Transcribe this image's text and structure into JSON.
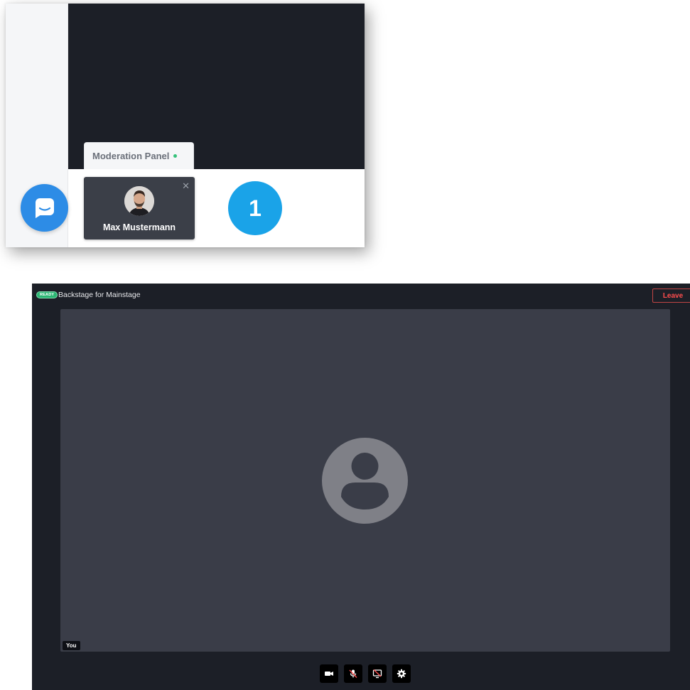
{
  "inset": {
    "tab_label": "Moderation Panel",
    "user_card": {
      "name": "Max Mustermann",
      "close_glyph": "✕"
    },
    "step_number": "1",
    "icons": {
      "chat": "chat-bubble-icon",
      "close": "close-icon",
      "status": "online-dot-icon"
    }
  },
  "stage": {
    "status_badge": "READY",
    "title": "Backstage for Mainstage",
    "leave_label": "Leave",
    "self_label": "You",
    "controls": [
      {
        "name": "camera-button",
        "icon": "video-camera-icon"
      },
      {
        "name": "microphone-button",
        "icon": "microphone-muted-icon"
      },
      {
        "name": "screen-share-button",
        "icon": "screen-share-off-icon"
      },
      {
        "name": "settings-button",
        "icon": "gear-icon"
      }
    ]
  },
  "colors": {
    "dark_bg": "#1c1f27",
    "tile_bg": "#3a3d48",
    "accent_blue": "#1aa3e8",
    "chat_blue": "#2d8ce6",
    "ready_green": "#2bb673",
    "leave_red": "#ff4d4d"
  }
}
